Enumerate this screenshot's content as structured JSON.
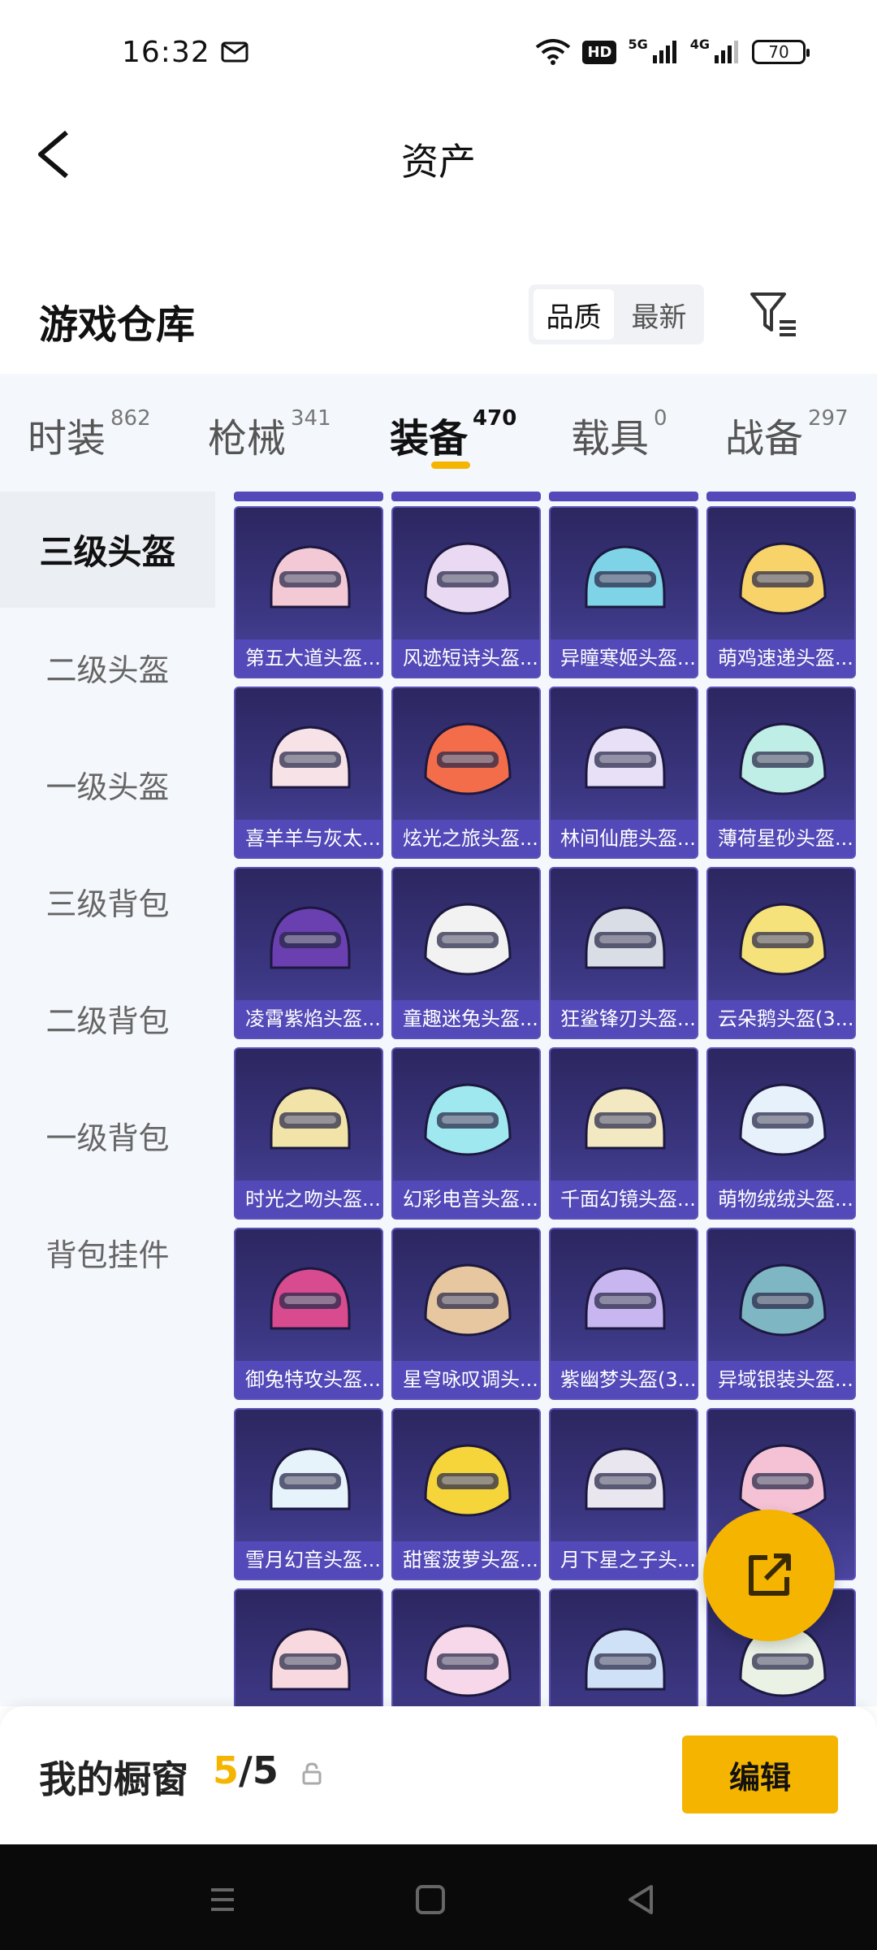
{
  "status_bar": {
    "time": "16:32",
    "hd_badge": "HD",
    "net_5g": "5G",
    "net_4g": "4G",
    "battery": "70",
    "icons": [
      "mail-icon",
      "wifi-icon",
      "signal-icon",
      "battery-icon"
    ]
  },
  "header": {
    "title": "资产",
    "back_icon": "chevron-left-icon"
  },
  "warehouse": {
    "title": "游戏仓库",
    "sort_options": [
      "品质",
      "最新"
    ],
    "sort_selected": "品质",
    "filter_icon": "filter-icon"
  },
  "categories": [
    {
      "name": "时装",
      "count": "862"
    },
    {
      "name": "枪械",
      "count": "341"
    },
    {
      "name": "装备",
      "count": "470",
      "active": true
    },
    {
      "name": "载具",
      "count": "0"
    },
    {
      "name": "战备",
      "count": "297"
    }
  ],
  "sidebar": {
    "items": [
      "三级头盔",
      "二级头盔",
      "一级头盔",
      "三级背包",
      "二级背包",
      "一级背包",
      "背包挂件"
    ],
    "selected": "三级头盔"
  },
  "items": [
    {
      "name": "第五大道头盔..."
    },
    {
      "name": "风迹短诗头盔..."
    },
    {
      "name": "异瞳寒姬头盔..."
    },
    {
      "name": "萌鸡速递头盔..."
    },
    {
      "name": "喜羊羊与灰太..."
    },
    {
      "name": "炫光之旅头盔..."
    },
    {
      "name": "林间仙鹿头盔..."
    },
    {
      "name": "薄荷星砂头盔..."
    },
    {
      "name": "凌霄紫焰头盔..."
    },
    {
      "name": "童趣迷兔头盔..."
    },
    {
      "name": "狂鲨锋刃头盔..."
    },
    {
      "name": "云朵鹅头盔(3..."
    },
    {
      "name": "时光之吻头盔..."
    },
    {
      "name": "幻彩电音头盔..."
    },
    {
      "name": "千面幻镜头盔..."
    },
    {
      "name": "萌物绒绒头盔..."
    },
    {
      "name": "御兔特攻头盔..."
    },
    {
      "name": "星穹咏叹调头..."
    },
    {
      "name": "紫幽梦头盔(3..."
    },
    {
      "name": "异域银装头盔..."
    },
    {
      "name": "雪月幻音头盔..."
    },
    {
      "name": "甜蜜菠萝头盔..."
    },
    {
      "name": "月下星之子头..."
    },
    {
      "name": ""
    },
    {
      "name": ""
    },
    {
      "name": ""
    },
    {
      "name": ""
    },
    {
      "name": ""
    }
  ],
  "item_colors": [
    "#f3c9d6",
    "#e9d9f2",
    "#7fd3e6",
    "#f7d36a",
    "#f7e2e8",
    "#f46d4a",
    "#e8e0f7",
    "#bfeee6",
    "#6a3fb0",
    "#f2f2f2",
    "#d9dde6",
    "#f6e27a",
    "#f2e3a8",
    "#9fe8f0",
    "#f2e9c2",
    "#e6f1fb",
    "#d84b8f",
    "#e7c7a0",
    "#c8b6f0",
    "#7fb6c4",
    "#e6f3fb",
    "#f5d53a",
    "#e9e6ef",
    "#f5c2d5",
    "#f7d9df",
    "#f6d8ea",
    "#cfe1f6",
    "#eaf2e6"
  ],
  "share_fab": {
    "icon": "share-icon"
  },
  "showcase": {
    "label": "我的橱窗",
    "current": "5",
    "sep": "/",
    "total": "5",
    "lock_icon": "lock-icon",
    "edit_label": "编辑"
  },
  "nav_bar": {
    "icons": [
      "menu-icon",
      "home-icon",
      "back-icon"
    ]
  }
}
